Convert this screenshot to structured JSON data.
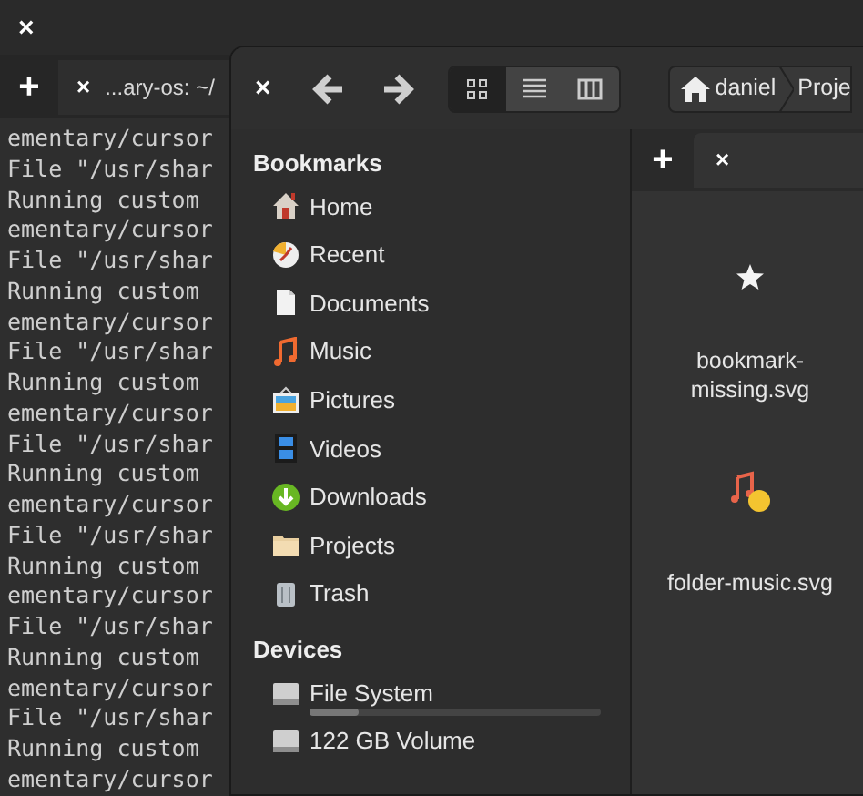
{
  "terminal": {
    "close": "×",
    "new_tab": "+",
    "tab": {
      "close": "×",
      "title": "...ary-os: ~/"
    },
    "lines": [
      "ementary/cursor",
      "File \"/usr/shar",
      "Running custom",
      "ementary/cursor",
      "File \"/usr/shar",
      "Running custom",
      "ementary/cursor",
      "File \"/usr/shar",
      "Running custom",
      "ementary/cursor",
      "File \"/usr/shar",
      "Running custom",
      "ementary/cursor",
      "File \"/usr/shar",
      "Running custom",
      "ementary/cursor",
      "File \"/usr/shar",
      "Running custom",
      "ementary/cursor",
      "File \"/usr/shar",
      "Running custom",
      "ementary/cursor"
    ]
  },
  "files": {
    "close": "×",
    "view_modes": [
      {
        "kind": "icons",
        "selected": true
      },
      {
        "kind": "list",
        "selected": false
      },
      {
        "kind": "columns",
        "selected": false
      }
    ],
    "breadcrumb": [
      "daniel",
      "Proje"
    ],
    "sidebar": [
      {
        "heading": "Bookmarks",
        "items": [
          {
            "label": "Home",
            "kind": "home"
          },
          {
            "label": "Recent",
            "kind": "recent"
          },
          {
            "label": "Documents",
            "kind": "document"
          },
          {
            "label": "Music",
            "kind": "music"
          },
          {
            "label": "Pictures",
            "kind": "pictures"
          },
          {
            "label": "Videos",
            "kind": "videos"
          },
          {
            "label": "Downloads",
            "kind": "downloads"
          },
          {
            "label": "Projects",
            "kind": "folder"
          },
          {
            "label": "Trash",
            "kind": "trash"
          }
        ]
      },
      {
        "heading": "Devices",
        "items": [
          {
            "label": "File System",
            "kind": "drive",
            "level": 0.17
          },
          {
            "label": "122 GB Volume",
            "kind": "drive"
          }
        ]
      }
    ],
    "tabs": {
      "new_tab": "+",
      "tab_close": "×"
    },
    "items": [
      {
        "name": "bookmark-\nmissing.svg",
        "kind": "star"
      },
      {
        "name": "folder-music.svg",
        "kind": "music"
      }
    ]
  }
}
